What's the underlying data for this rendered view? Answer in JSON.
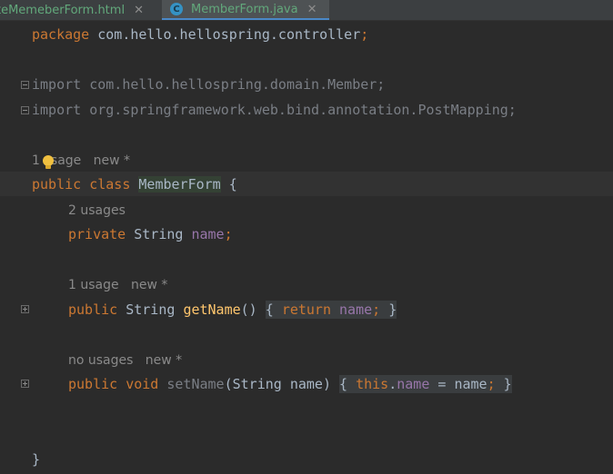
{
  "tabs": [
    {
      "label": "teMemeberForm.html",
      "active": false
    },
    {
      "label": "MemberForm.java",
      "active": true,
      "icon": "C"
    }
  ],
  "code": {
    "package_kw": "package",
    "package_name": " com.hello.hellospring.controller",
    "semicolon": ";",
    "import1": "import com.hello.hellospring.domain.Member;",
    "import2": "import org.springframework.web.bind.annotation.PostMapping;",
    "class_hint_a": "1",
    "class_hint_b": "sage   new *",
    "public": "public",
    "class_kw": "class",
    "class_name": "MemberForm",
    "open_brace": " {",
    "field_hint": "2 usages",
    "private": "private",
    "type_string": "String",
    "field_name": "name",
    "getter_hint": "1 usage   new *",
    "getter_name": "getName",
    "parens": "()",
    "block_open": "{ ",
    "return_kw": "return",
    "block_close": " }",
    "setter_hint": "no usages   new *",
    "void_kw": "void",
    "setter_name": "setName",
    "setter_params": "(String name)",
    "this_kw": "this",
    "dot": ".",
    "assign": " = name",
    "closing_brace": "}"
  },
  "colors": {
    "background": "#2b2b2b",
    "keyword": "#cc7832",
    "field": "#9876aa",
    "method": "#ffc66d",
    "text": "#a9b7c6",
    "tab_text": "#62a87b"
  }
}
